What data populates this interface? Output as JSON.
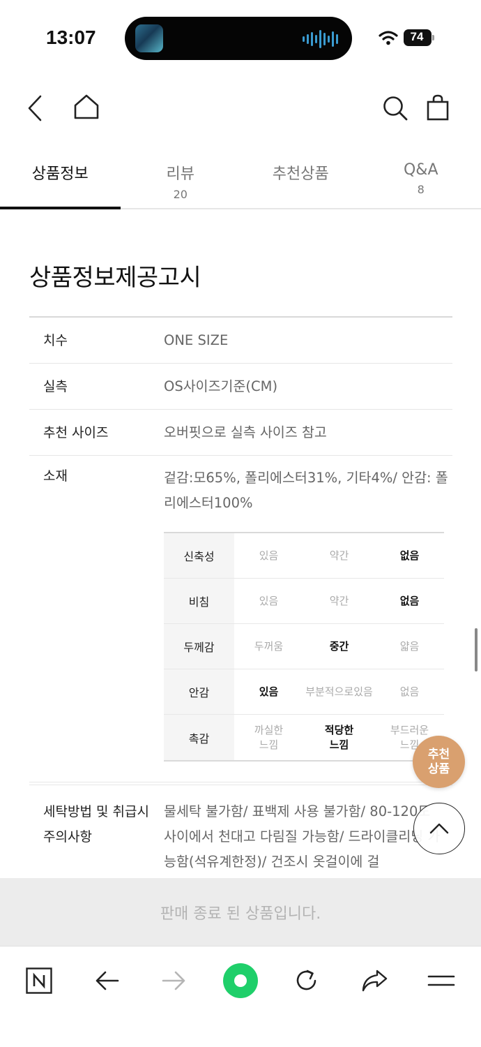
{
  "status_bar": {
    "time": "13:07",
    "battery": "74"
  },
  "tabs": [
    {
      "label": "상품정보",
      "count": ""
    },
    {
      "label": "리뷰",
      "count": "20"
    },
    {
      "label": "추천상품",
      "count": ""
    },
    {
      "label": "Q&A",
      "count": "8"
    }
  ],
  "section_title": "상품정보제공고시",
  "info_rows": [
    {
      "label": "치수",
      "value": "ONE SIZE"
    },
    {
      "label": "실측",
      "value": "OS사이즈기준(CM)"
    },
    {
      "label": "추천 사이즈",
      "value": "오버핏으로 실측 사이즈 참고"
    },
    {
      "label": "소재",
      "value": "겉감:모65%, 폴리에스터31%, 기타4%/ 안감: 폴리에스터100%"
    }
  ],
  "grade_table": [
    {
      "head": "신축성",
      "options": [
        "있음",
        "약간",
        "없음"
      ],
      "selected": 2
    },
    {
      "head": "비침",
      "options": [
        "있음",
        "약간",
        "없음"
      ],
      "selected": 2
    },
    {
      "head": "두께감",
      "options": [
        "두꺼움",
        "중간",
        "얇음"
      ],
      "selected": 1
    },
    {
      "head": "안감",
      "options": [
        "있음",
        "부분적으로있음",
        "없음"
      ],
      "selected": 0
    },
    {
      "head": "촉감",
      "options": [
        "까실한\n느낌",
        "적당한\n느낌",
        "부드러운\n느낌"
      ],
      "selected": 1
    }
  ],
  "care": {
    "label": "세탁방법 및 취급시 주의사항",
    "value": "물세탁 불가함/ 표백제 사용 불가함/ 80-120도 사이에서 천대고 다림질 가능함/ 드라이클리닝 가능함(석유계한정)/ 건조시 옷걸이에 걸"
  },
  "recommend_fab": "추천\n상품",
  "soldout_text": "판매 종료 된 상품입니다.",
  "colors": {
    "accent_green": "#1fcf6a",
    "fab_orange": "#d9a06f",
    "soldout_bg": "#ececec"
  }
}
